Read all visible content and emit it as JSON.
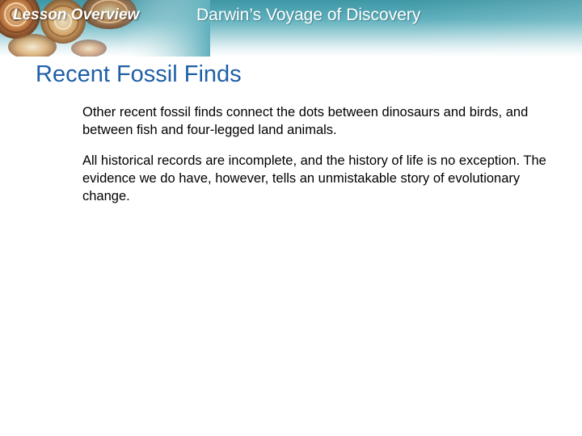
{
  "header": {
    "lesson_label": "Lesson Overview",
    "lesson_title": "Darwin’s Voyage of Discovery",
    "decoration": "seashell-cluster-icon"
  },
  "slide": {
    "title": "Recent Fossil Finds",
    "paragraphs": [
      "Other recent fossil finds connect the dots between dinosaurs and birds, and between fish and four-legged land animals.",
      "All historical records are incomplete, and the history of life is no exception. The evidence we do have, however, tells an unmistakable story of evolutionary change."
    ]
  },
  "colors": {
    "banner_teal": "#3f97a6",
    "title_blue": "#1f5fa8",
    "body_text": "#000000"
  }
}
